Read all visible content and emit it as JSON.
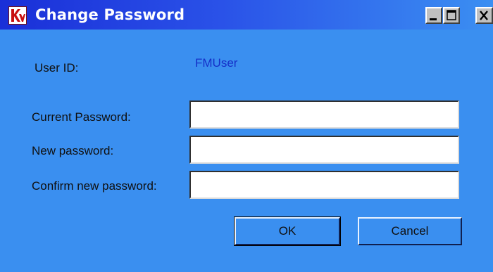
{
  "window": {
    "title": "Change Password",
    "icon": "app-logo-icon",
    "controls": {
      "minimize": "minimize-icon",
      "maximize": "maximize-icon",
      "close": "close-icon"
    }
  },
  "form": {
    "user_id_label": "User ID:",
    "user_id_value": "FMUser",
    "current_password_label": "Current Password:",
    "current_password_value": "",
    "new_password_label": "New password:",
    "new_password_value": "",
    "confirm_password_label": "Confirm new password:",
    "confirm_password_value": ""
  },
  "buttons": {
    "ok_label": "OK",
    "cancel_label": "Cancel"
  },
  "colors": {
    "background": "#3a8ff0",
    "titlebar_start": "#1a2fd8",
    "titlebar_end": "#3b8ff2",
    "user_id_value": "#1530c8"
  }
}
